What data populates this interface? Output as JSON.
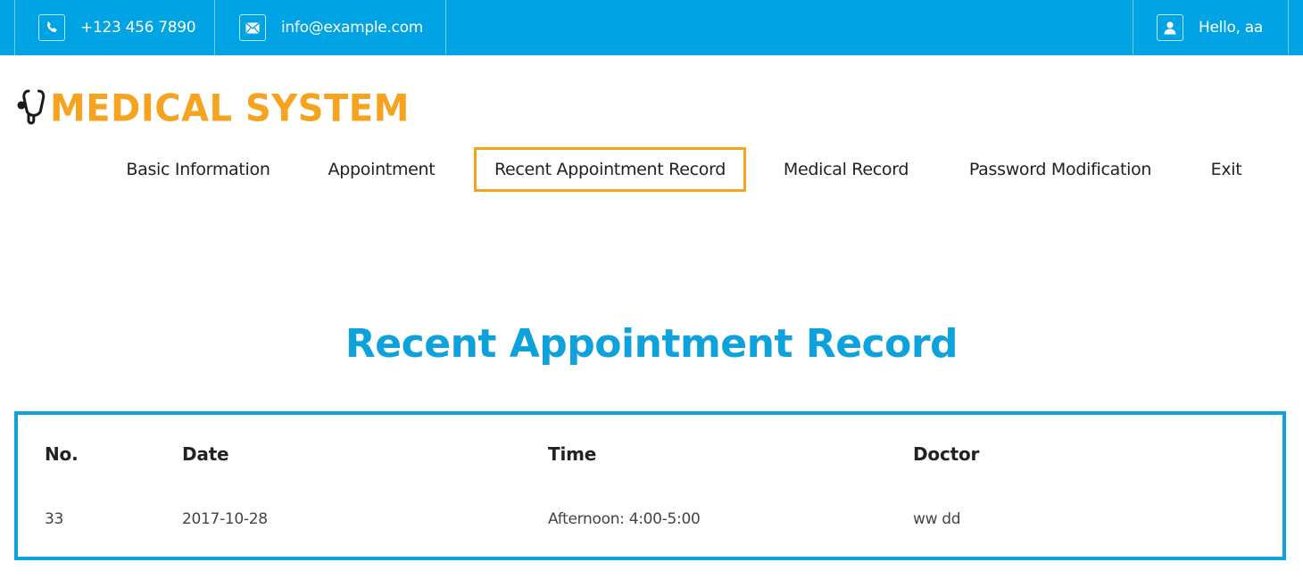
{
  "topbar": {
    "phone": "+123 456 7890",
    "email": "info@example.com",
    "greeting": "Hello, aa",
    "icons": [
      "phone-icon",
      "mail-icon",
      "user-icon"
    ],
    "background_color": "#00a3e4"
  },
  "brand": {
    "name": "MEDICAL SYSTEM",
    "logo_icon": "stethoscope-icon",
    "color": "#f6a31f"
  },
  "nav": {
    "items": [
      {
        "label": "Basic Information"
      },
      {
        "label": "Appointment"
      },
      {
        "label": "Recent Appointment Record",
        "active": true
      },
      {
        "label": "Medical Record"
      },
      {
        "label": "Password Modification"
      },
      {
        "label": "Exit"
      }
    ],
    "active_color": "#f6a31f"
  },
  "page": {
    "title": "Recent Appointment Record",
    "accent_color": "#0ea2dd"
  },
  "table": {
    "headers": [
      "No.",
      "Date",
      "Time",
      "Doctor"
    ],
    "rows": [
      [
        "33",
        "2017-10-28",
        "Afternoon: 4:00-5:00",
        "ww dd"
      ]
    ]
  }
}
